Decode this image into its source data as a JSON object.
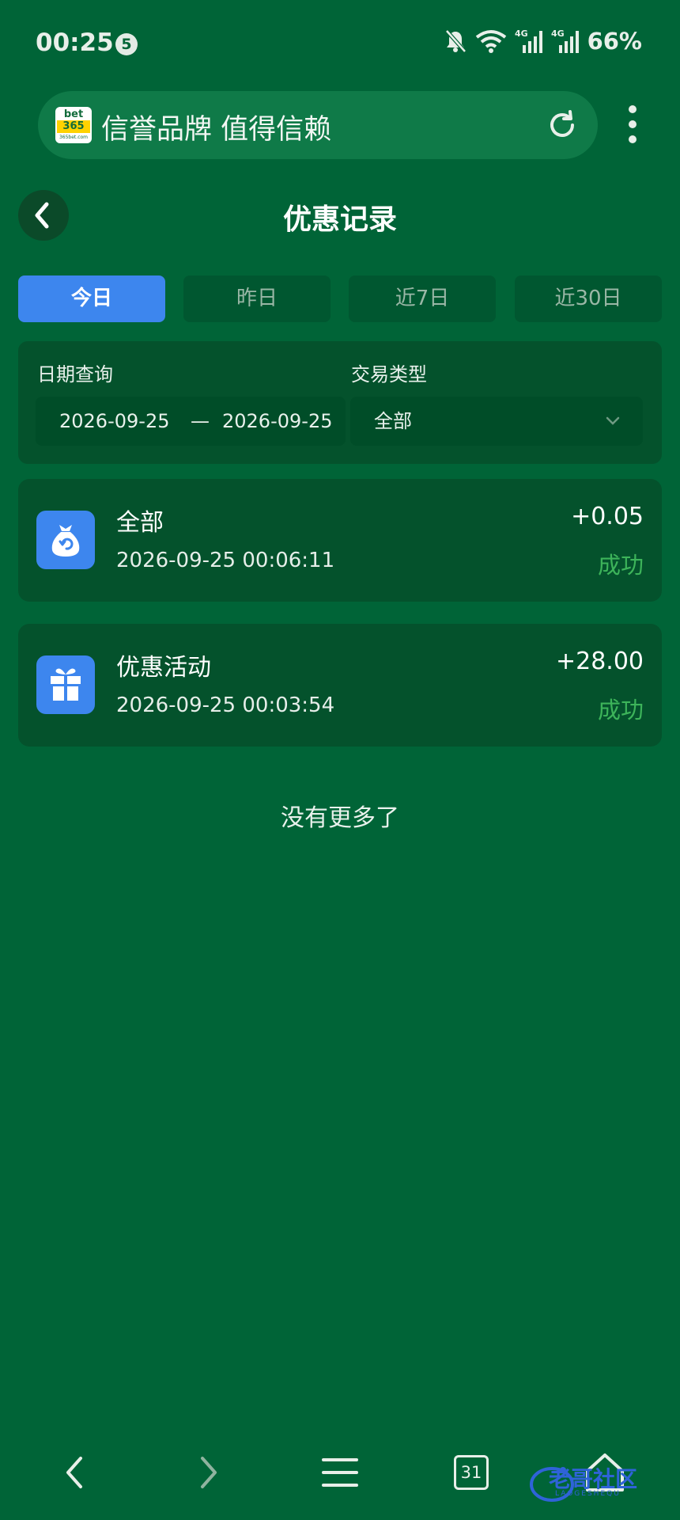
{
  "status_bar": {
    "time": "00:25",
    "notification_count": "5",
    "network_1": "4G",
    "network_2": "4G",
    "battery": "66%"
  },
  "browser": {
    "site_logo_top": "bet",
    "site_logo_middle": "365",
    "site_logo_bottom": "365bet.com",
    "address_text": "信誉品牌 值得信赖",
    "tab_count": "31"
  },
  "header": {
    "title": "优惠记录"
  },
  "tabs": [
    {
      "label": "今日",
      "active": true
    },
    {
      "label": "昨日",
      "active": false
    },
    {
      "label": "近7日",
      "active": false
    },
    {
      "label": "近30日",
      "active": false
    }
  ],
  "filters": {
    "date_label": "日期查询",
    "date_start": "2026-09-25",
    "date_separator": "—",
    "date_end": "2026-09-25",
    "type_label": "交易类型",
    "type_value": "全部"
  },
  "records": [
    {
      "icon": "money-bag-icon",
      "title": "全部",
      "time": "2026-09-25 00:06:11",
      "amount": "+0.05",
      "status": "成功"
    },
    {
      "icon": "gift-icon",
      "title": "优惠活动",
      "time": "2026-09-25 00:03:54",
      "amount": "+28.00",
      "status": "成功"
    }
  ],
  "no_more_text": "没有更多了",
  "watermark": {
    "text": "老哥社区",
    "sub": "LAOGESHEQU"
  },
  "colors": {
    "background": "#006437",
    "accent": "#3d86ee",
    "success": "#3db45a"
  }
}
